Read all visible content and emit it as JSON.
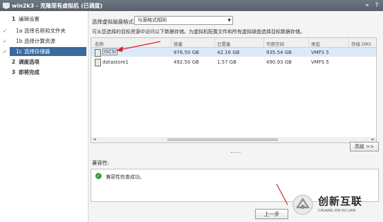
{
  "window": {
    "title": "win2k3 - 克隆现有虚拟机 (已调度)",
    "expand_glyph": "»",
    "help_glyph": "?"
  },
  "steps": [
    {
      "num": "1",
      "label": "编辑设置",
      "status": "heading"
    },
    {
      "num": "1a",
      "label": "选择名称和文件夹",
      "status": "done"
    },
    {
      "num": "1b",
      "label": "选择计算资源",
      "status": "done"
    },
    {
      "num": "1c",
      "label": "选择存储器",
      "status": "active"
    },
    {
      "num": "2",
      "label": "调度选项",
      "status": "heading"
    },
    {
      "num": "3",
      "label": "即将完成",
      "status": "heading"
    }
  ],
  "check_glyph": "✓",
  "format": {
    "label": "选择虚拟磁盘格式:",
    "value": "与源格式相同",
    "arrow": "▼"
  },
  "hint": "可从您选择的目标资源中访问以下数据存储。为虚拟机配置文件和所有虚拟磁盘选择目标数据存储。",
  "table": {
    "columns": [
      "名称",
      "容量",
      "已置备",
      "可用空间",
      "类型",
      "存储 DRS"
    ],
    "rows": [
      {
        "name": "ISCSI",
        "capacity": "976.50 GB",
        "provisioned": "42.16 GB",
        "free": "935.54 GB",
        "type": "VMFS 5",
        "sdrs": ""
      },
      {
        "name": "datastore1",
        "capacity": "492.50 GB",
        "provisioned": "1.57 GB",
        "free": "490.93 GB",
        "type": "VMFS 5",
        "sdrs": ""
      }
    ],
    "selected_row": 0,
    "scroll_left": "◄",
    "scroll_right": "►"
  },
  "advanced_button": "高级 >>",
  "compat": {
    "label": "兼容性:",
    "message": "兼容性检查成功。",
    "icon": "check-circle-icon"
  },
  "back_button": "上一步",
  "watermark": {
    "cn": "创新互联",
    "en": "CHUANG XIN HU LIAN"
  },
  "colors": {
    "active_step": "#3a6a9e",
    "selected_row": "#dceaf8",
    "annotation_arrow": "#d6202b",
    "success": "#3a9b3a"
  }
}
